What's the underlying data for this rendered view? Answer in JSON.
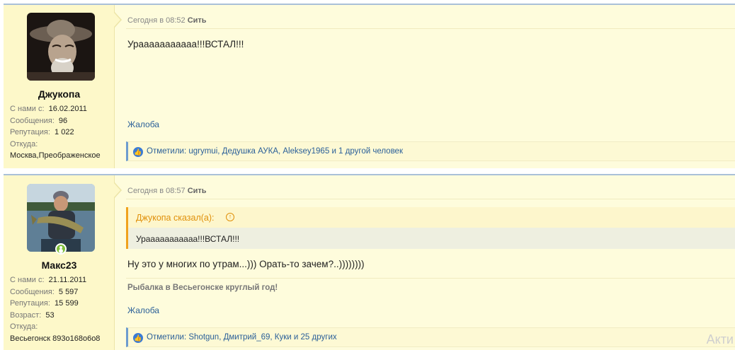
{
  "posts": [
    {
      "author": "Джукопа",
      "stats": [
        {
          "key": "С нами с:",
          "value": "16.02.2011"
        },
        {
          "key": "Сообщения:",
          "value": "96"
        },
        {
          "key": "Репутация:",
          "value": "1 022"
        },
        {
          "key": "Откуда:",
          "value": ""
        },
        {
          "key": "",
          "value": "Москва,Преображенское"
        }
      ],
      "date": "Сегодня в 08:52",
      "date_author": "Сить",
      "message": "Урааааааааааа!!!ВСТАЛ!!!",
      "report": "Жалоба",
      "likes_label": "Отметили:",
      "likes_users": "ugrymui, Дедушка АУКА, Aleksey1965",
      "likes_others": "и 1 другой человек"
    },
    {
      "author": "Макс23",
      "online": true,
      "stats": [
        {
          "key": "С нами с:",
          "value": "21.11.2011"
        },
        {
          "key": "Сообщения:",
          "value": "5 597"
        },
        {
          "key": "Репутация:",
          "value": "15 599"
        },
        {
          "key": "Возраст:",
          "value": "53"
        },
        {
          "key": "Откуда:",
          "value": ""
        },
        {
          "key": "",
          "value": "Весьегонск 893о168о6о8"
        }
      ],
      "date": "Сегодня в 08:57",
      "date_author": "Сить",
      "quote_author": "Джукопа сказал(а):",
      "quote_text": "Урааааааааааа!!!ВСТАЛ!!!",
      "message": "Ну это у многих по утрам...))) Орать-то зачем?..))))))))",
      "signature": "Рыбалка в Весьегонске круглый год!",
      "report": "Жалоба",
      "likes_label": "Отметили:",
      "likes_users": "Shotgun, Дмитрий_69, Куки",
      "likes_others": "и 25 других"
    }
  ],
  "watermark": "Акти",
  "colors": {
    "accent": "#2b6099",
    "quote": "#f0a21c",
    "post_bg": "#fefcdc"
  }
}
